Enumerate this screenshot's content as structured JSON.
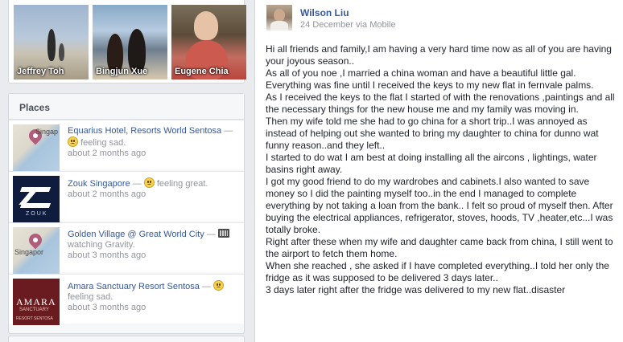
{
  "friends": [
    {
      "name": "Jeffrey Toh"
    },
    {
      "name": "Bingjun Xue"
    },
    {
      "name": "Eugene Chia"
    }
  ],
  "places": {
    "title": "Places",
    "items": [
      {
        "name": "Equarius Hotel, Resorts World Sentosa",
        "sep": "—",
        "activity": "feeling sad.",
        "time": "about 2 months ago",
        "thumb_label": "Singap",
        "icon": "sad-emoji-icon"
      },
      {
        "name": "Zouk Singapore",
        "sep": "—",
        "activity": "feeling great.",
        "time": "about 2 months ago",
        "thumb_label": "ZOUK",
        "icon": "happy-emoji-icon"
      },
      {
        "name": "Golden Village @ Great World City",
        "sep": "—",
        "activity": "watching Gravity.",
        "time": "about 3 months ago",
        "thumb_label": "Singapor",
        "icon": "film-icon"
      },
      {
        "name": "Amara Sanctuary Resort Sentosa",
        "sep": "—",
        "activity": "feeling sad.",
        "time": "about 3 months ago",
        "thumb_label": "AMARA",
        "thumb_sub": "SANCTUARY",
        "thumb_foot": "RESORT SENTOSA",
        "icon": "sad-emoji-icon"
      }
    ]
  },
  "post": {
    "author": "Wilson Liu",
    "meta": "24 December via Mobile",
    "paragraphs": [
      "Hi all friends and family,I am having a very hard time now as all of you are having your joyous season..",
      "As all of you noe ,I married a china woman and have a beautiful little gal.",
      "Everything was fine until I received the keys to my new flat in fernvale palms.",
      "As I received the keys to the flat I started of with the renovations ,paintings and all the necessary things for the new house me and my family was moving in.",
      "Then my wife told me she had to go china for a short trip..I was annoyed as instead of helping out she wanted to bring my daughter to china for dunno wat funny reason..and they left..",
      "I started to do wat I am best at doing installing all the aircons , lightings, water basins right away.",
      "I got my good friend to do my wardrobes and cabinets.I also wanted to save money so I did the painting myself too..in the end I managed to complete everything by not taking a loan from the bank.. I felt so proud of myself then. After buying the electrical appliances, refrigerator, stoves, hoods, TV ,heater,etc...I was totally broke.",
      "Right after these when my wife and daughter came back from china, I still went to the airport to fetch them home.",
      "When she reached , she asked if I have completed everything..I told her only the fridge as it was supposed to be delivered 3 days later..",
      "3 days later right after the fridge was delivered to my new flat..disaster"
    ]
  }
}
